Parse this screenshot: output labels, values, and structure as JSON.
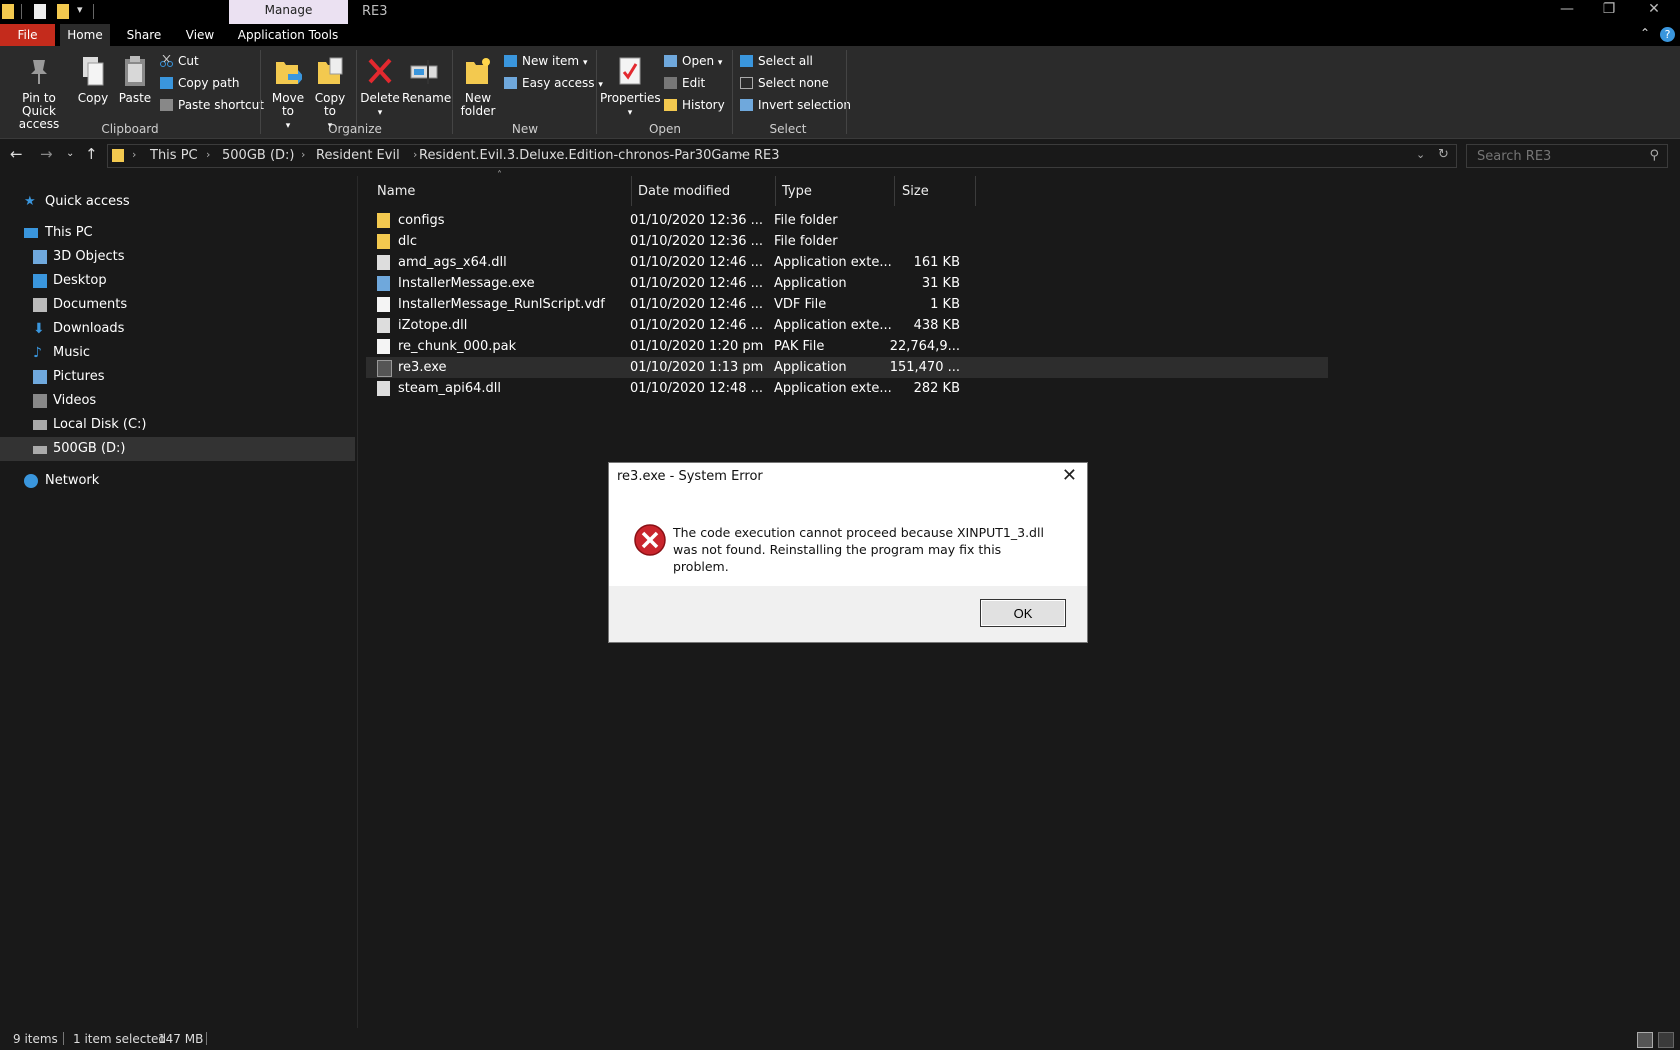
{
  "window": {
    "title": "RE3",
    "context_tab": "Manage"
  },
  "ribbon_tabs": {
    "file": "File",
    "home": "Home",
    "share": "Share",
    "view": "View",
    "app_tools": "Application Tools"
  },
  "clipboard": {
    "pin": "Pin to Quick access",
    "copy": "Copy",
    "paste": "Paste",
    "cut": "Cut",
    "copy_path": "Copy path",
    "paste_shortcut": "Paste shortcut",
    "group": "Clipboard"
  },
  "organize": {
    "move_to": "Move to",
    "copy_to": "Copy to",
    "delete": "Delete",
    "rename": "Rename",
    "group": "Organize"
  },
  "new_group": {
    "new_folder": "New folder",
    "new_item": "New item",
    "easy_access": "Easy access",
    "group": "New"
  },
  "open_group": {
    "properties": "Properties",
    "open": "Open",
    "edit": "Edit",
    "history": "History",
    "group": "Open"
  },
  "select_group": {
    "select_all": "Select all",
    "select_none": "Select none",
    "invert": "Invert selection",
    "group": "Select"
  },
  "breadcrumb": [
    "This PC",
    "500GB (D:)",
    "Resident Evil",
    "Resident.Evil.3.Deluxe.Edition-chronos-Par30Game",
    "RE3"
  ],
  "search": {
    "placeholder": "Search RE3"
  },
  "nav": {
    "quick_access": "Quick access",
    "this_pc": "This PC",
    "items": [
      "3D Objects",
      "Desktop",
      "Documents",
      "Downloads",
      "Music",
      "Pictures",
      "Videos",
      "Local Disk (C:)",
      "500GB (D:)"
    ],
    "network": "Network"
  },
  "columns": {
    "name": "Name",
    "date": "Date modified",
    "type": "Type",
    "size": "Size"
  },
  "files": [
    {
      "name": "configs",
      "date": "01/10/2020 12:36 ...",
      "type": "File folder",
      "size": "",
      "icon": "folder-icon"
    },
    {
      "name": "dlc",
      "date": "01/10/2020 12:36 ...",
      "type": "File folder",
      "size": "",
      "icon": "folder-icon"
    },
    {
      "name": "amd_ags_x64.dll",
      "date": "01/10/2020 12:46 ...",
      "type": "Application exte...",
      "size": "161 KB",
      "icon": "dll-file-icon"
    },
    {
      "name": "InstallerMessage.exe",
      "date": "01/10/2020 12:46 ...",
      "type": "Application",
      "size": "31 KB",
      "icon": "exe-file-icon"
    },
    {
      "name": "InstallerMessage_RunlScript.vdf",
      "date": "01/10/2020 12:46 ...",
      "type": "VDF File",
      "size": "1 KB",
      "icon": "document-file-icon"
    },
    {
      "name": "iZotope.dll",
      "date": "01/10/2020 12:46 ...",
      "type": "Application exte...",
      "size": "438 KB",
      "icon": "dll-file-icon"
    },
    {
      "name": "re_chunk_000.pak",
      "date": "01/10/2020 1:20 pm",
      "type": "PAK File",
      "size": "22,764,9...",
      "icon": "document-file-icon"
    },
    {
      "name": "re3.exe",
      "date": "01/10/2020 1:13 pm",
      "type": "Application",
      "size": "151,470 ...",
      "icon": "re3-app-icon"
    },
    {
      "name": "steam_api64.dll",
      "date": "01/10/2020 12:48 ...",
      "type": "Application exte...",
      "size": "282 KB",
      "icon": "dll-file-icon"
    }
  ],
  "status": {
    "items": "9 items",
    "selected": "1 item selected",
    "size": "147 MB"
  },
  "dialog": {
    "title": "re3.exe - System Error",
    "message": "The code execution cannot proceed because XINPUT1_3.dll was not found. Reinstalling the program may fix this problem.",
    "ok": "OK"
  },
  "colors": {
    "file_tab": "#c42b1c",
    "manage_tab": "#ebe1f2",
    "folder": "#f3c94f",
    "error_red": "#c9252c",
    "accent": "#3a96dd"
  }
}
